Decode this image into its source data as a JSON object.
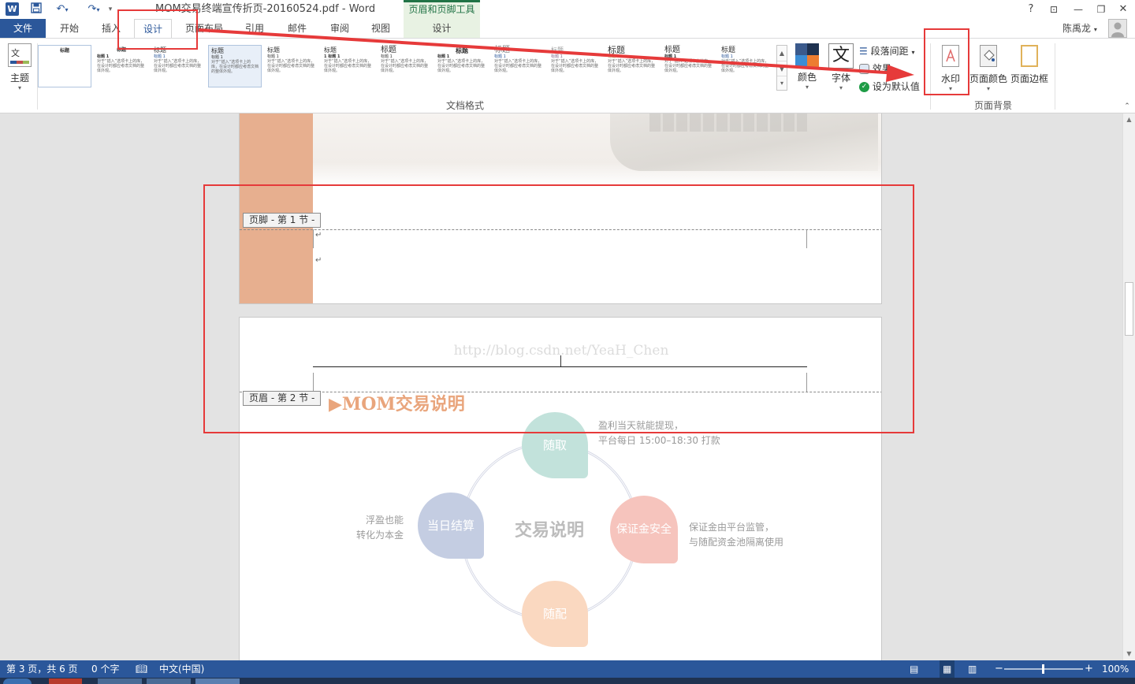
{
  "title_bar": {
    "doc_title": "MOM交易终端宣传折页-20160524.pdf - Word",
    "context_tool_label": "页眉和页脚工具",
    "help": "?",
    "ribbon_options": "⊡",
    "minimize": "—",
    "restore": "❐",
    "close": "✕"
  },
  "tabs": {
    "file": "文件",
    "home": "开始",
    "insert": "插入",
    "design": "设计",
    "layout": "页面布局",
    "references": "引用",
    "mailings": "邮件",
    "review": "审阅",
    "view": "视图",
    "hf_design": "设计",
    "user": "陈禹龙"
  },
  "ribbon": {
    "theme_label": "主题",
    "group_doc_format": "文档格式",
    "styles": [
      {
        "heading": "标题",
        "sub": ""
      },
      {
        "heading": "标题",
        "sub": "标题 1"
      },
      {
        "heading": "标题",
        "sub": "标题 1"
      },
      {
        "heading": "标题",
        "sub": "标题 1"
      },
      {
        "heading": "标题",
        "sub": "标题 1"
      },
      {
        "heading": "标题",
        "sub": "1 标题 1"
      },
      {
        "heading": "标题",
        "sub": "标题 1"
      },
      {
        "heading": "标题",
        "sub": "标题 1"
      },
      {
        "heading": "标题",
        "sub": "标题 1"
      },
      {
        "heading": "标题",
        "sub": "标题 1"
      },
      {
        "heading": "标题",
        "sub": "标题 1"
      },
      {
        "heading": "标题",
        "sub": "标题 1"
      },
      {
        "heading": "标题",
        "sub": "标题 1"
      }
    ],
    "colors_label": "颜色",
    "fonts_label": "字体",
    "fonts_glyph": "文",
    "paragraph_spacing": "段落间距",
    "effects": "效果",
    "set_default": "设为默认值",
    "watermark": "水印",
    "page_color": "页面颜色",
    "page_borders": "页面边框",
    "group_page_background": "页面背景"
  },
  "document": {
    "footer_tag": "页脚 - 第 1 节 -",
    "header_tag": "页眉 - 第 2 节 -",
    "watermark_url": "http://blog.csdn.net/YeaH_Chen",
    "heading": "▶MOM交易说明",
    "center_title": "交易说明",
    "bubbles": {
      "top": "随取",
      "left": "当日结算",
      "right": "保证金安全",
      "bottom": "随配"
    },
    "notes": {
      "top_line1": "盈利当天就能提现，",
      "top_line2": "平台每日 15:00–18:30 打款",
      "left_line1": "浮盈也能",
      "left_line2": "转化为本金",
      "right_line1": "保证金由平台监管，",
      "right_line2": "与随配资金池隔离使用"
    }
  },
  "status": {
    "page_info": "第 3 页，共 6 页",
    "word_count": "0 个字",
    "language": "中文(中国)",
    "zoom": "100%"
  },
  "colors": {
    "accent": "#2b579a",
    "context_green": "#217346",
    "red_annotation": "#e63a3a",
    "salmon": "#e7af8f"
  }
}
